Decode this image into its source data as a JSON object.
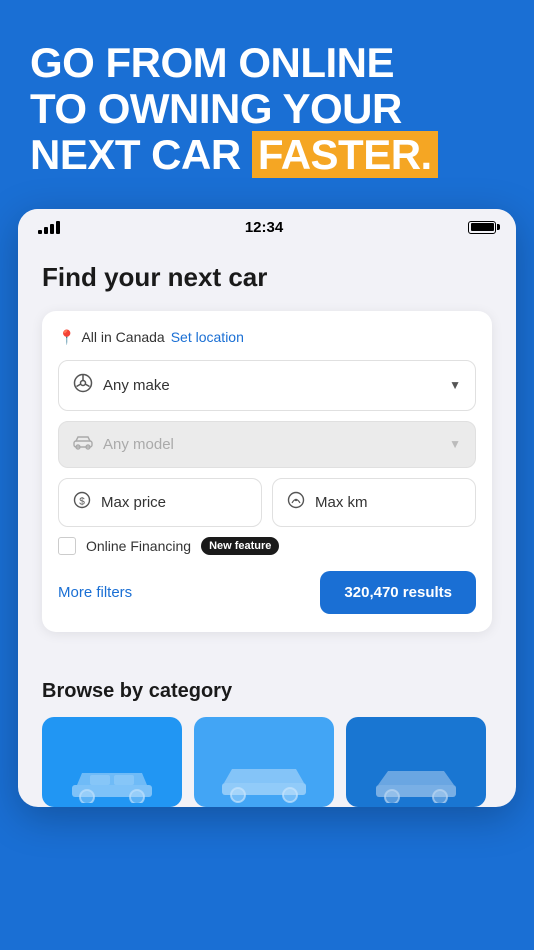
{
  "hero": {
    "line1": "GO FROM ONLINE",
    "line2": "TO OWNING YOUR",
    "line3_normal": "NEXT CAR ",
    "line3_highlight": "FASTER."
  },
  "status_bar": {
    "time": "12:34",
    "signal_bars": [
      4,
      7,
      10,
      13
    ],
    "battery_full": true
  },
  "search": {
    "title": "Find your next car",
    "location_text": "All in Canada",
    "set_location_label": "Set location",
    "make_placeholder": "Any make",
    "model_placeholder": "Any model",
    "max_price_placeholder": "Max price",
    "max_km_placeholder": "Max km",
    "online_financing_label": "Online Financing",
    "new_feature_badge": "New feature",
    "more_filters_label": "More filters",
    "results_label": "320,470 results"
  },
  "browse": {
    "title": "Browse by category"
  },
  "icons": {
    "location_pin": "📍",
    "steering_wheel": "⊙",
    "car": "🚗",
    "dollar": "$",
    "speedometer": "⊘",
    "chevron_down": "▼"
  }
}
